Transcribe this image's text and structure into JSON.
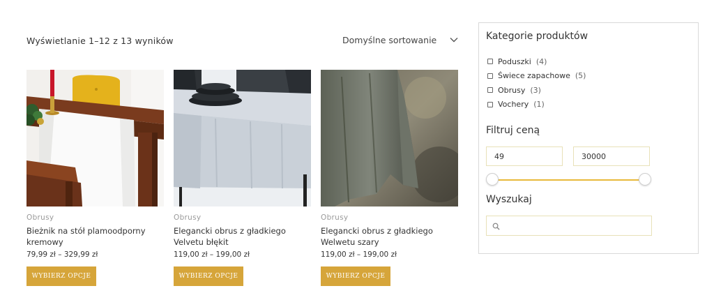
{
  "shop": {
    "result_count": "Wyświetlanie 1–12 z 13 wyników",
    "sort_label": "Domyślne sortowanie",
    "sort_icon": "chevron-down-icon"
  },
  "products": [
    {
      "category": "Obrusy",
      "title": "Bieżnik na stół plamoodporny kremowy",
      "price": "79,99 zł – 329,99 zł",
      "button": "WYBIERZ OPCJE"
    },
    {
      "category": "Obrusy",
      "title": "Elegancki obrus z gładkiego Velvetu błękit",
      "price": "119,00 zł – 199,00 zł",
      "button": "WYBIERZ OPCJE"
    },
    {
      "category": "Obrusy",
      "title": "Elegancki obrus z gładkiego Welwetu szary",
      "price": "119,00 zł – 199,00 zł",
      "button": "WYBIERZ OPCJE"
    }
  ],
  "sidebar": {
    "categories_title": "Kategorie produktów",
    "categories": [
      {
        "label": "Poduszki",
        "count": "(4)"
      },
      {
        "label": "Świece zapachowe",
        "count": "(5)"
      },
      {
        "label": "Obrusy",
        "count": "(3)"
      },
      {
        "label": "Vochery",
        "count": "(1)"
      }
    ],
    "price_title": "Filtruj ceną",
    "price_min": "49",
    "price_max": "30000",
    "search_title": "Wyszukaj",
    "search_placeholder": "",
    "search_icon": "search-icon"
  },
  "colors": {
    "accent": "#d6a53a",
    "slider": "#e8b93a",
    "input_border": "#e8e1b8"
  }
}
